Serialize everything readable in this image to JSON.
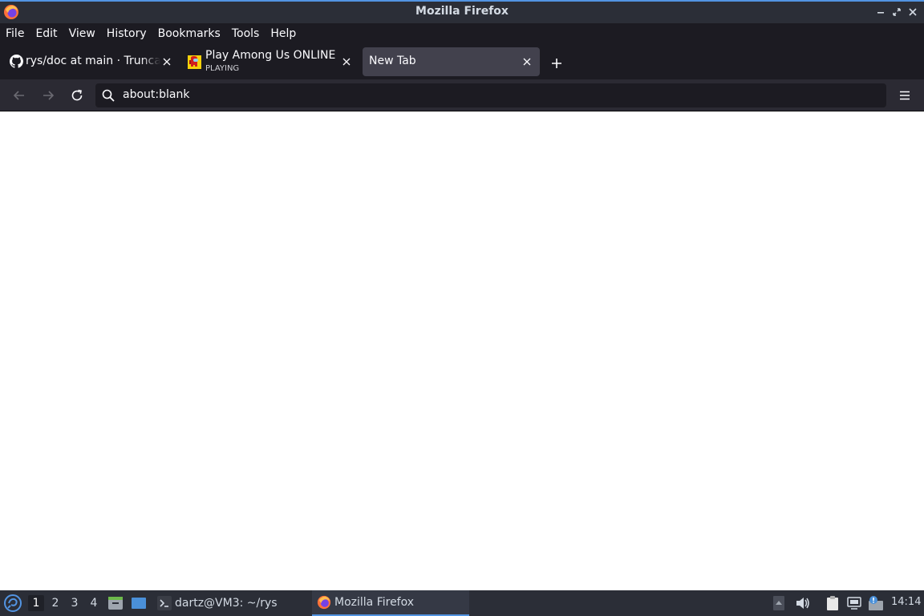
{
  "window": {
    "title": "Mozilla Firefox"
  },
  "menubar": {
    "items": [
      {
        "label": "File"
      },
      {
        "label": "Edit"
      },
      {
        "label": "View"
      },
      {
        "label": "History"
      },
      {
        "label": "Bookmarks"
      },
      {
        "label": "Tools"
      },
      {
        "label": "Help"
      }
    ]
  },
  "tabs": [
    {
      "label": "rys/doc at main · Truncat",
      "icon": "github-icon",
      "active": false
    },
    {
      "label": "Play Among Us ONLINE",
      "sublabel": "PLAYING",
      "icon": "among-us-icon",
      "active": false
    },
    {
      "label": "New Tab",
      "active": true
    }
  ],
  "urlbar": {
    "value": "about:blank"
  },
  "taskbar": {
    "workspaces": [
      "1",
      "2",
      "3",
      "4"
    ],
    "active_workspace": "1",
    "tasks": [
      {
        "label": "dartz@VM3: ~/rys",
        "icon": "terminal-icon"
      },
      {
        "label": "Mozilla Firefox",
        "icon": "firefox-icon",
        "active": true
      }
    ],
    "clock": "14:14"
  },
  "colors": {
    "accent": "#5294e2",
    "chrome_dark": "#1c1b22",
    "toolbar": "#2b2a33",
    "panel": "#2b2e37"
  }
}
